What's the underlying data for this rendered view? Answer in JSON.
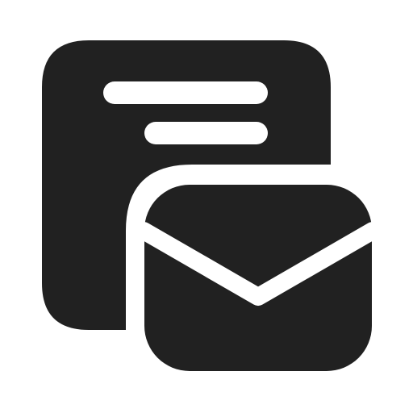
{
  "icon": {
    "name": "document-mail-icon",
    "fill_color": "#212121",
    "background_color": "#ffffff"
  }
}
